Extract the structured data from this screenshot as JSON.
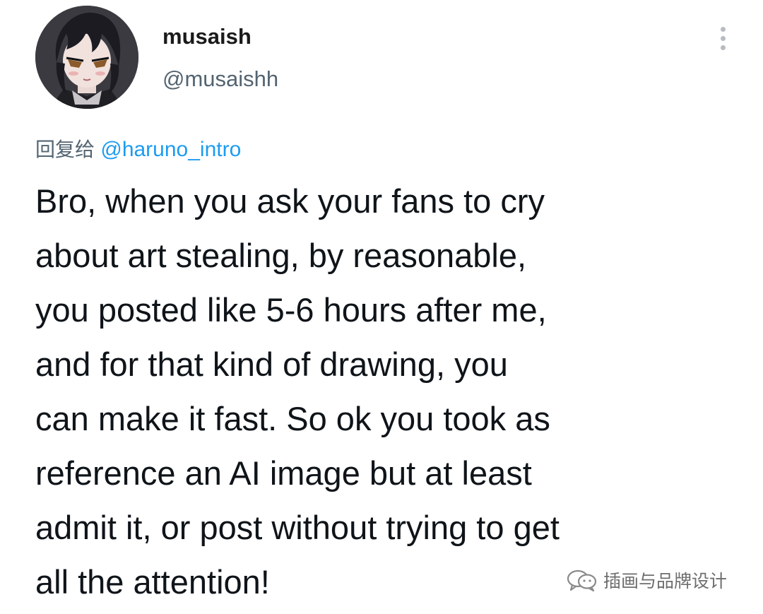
{
  "tweet": {
    "author": {
      "display_name": "musaish",
      "handle": "@musaishh",
      "avatar_icon": "anime-avatar-icon"
    },
    "more_icon": "more-vertical-icon",
    "reply_prefix": "回复给",
    "reply_to": "@haruno_intro",
    "text_lines": [
      "Bro, when you ask your fans to cry",
      "about art stealing, by reasonable,",
      "you posted like 5-6 hours after me,",
      "and for that kind of drawing, you",
      "can make it fast. So ok you took as",
      "reference an AI image but at least",
      "admit it, or post without trying to get",
      "all the attention!"
    ]
  },
  "watermark": {
    "icon": "wechat-channel-icon",
    "text": "插画与品牌设计"
  },
  "colors": {
    "text": "#0f1419",
    "secondary": "#536471",
    "link": "#1d9bf0",
    "background": "#ffffff"
  }
}
